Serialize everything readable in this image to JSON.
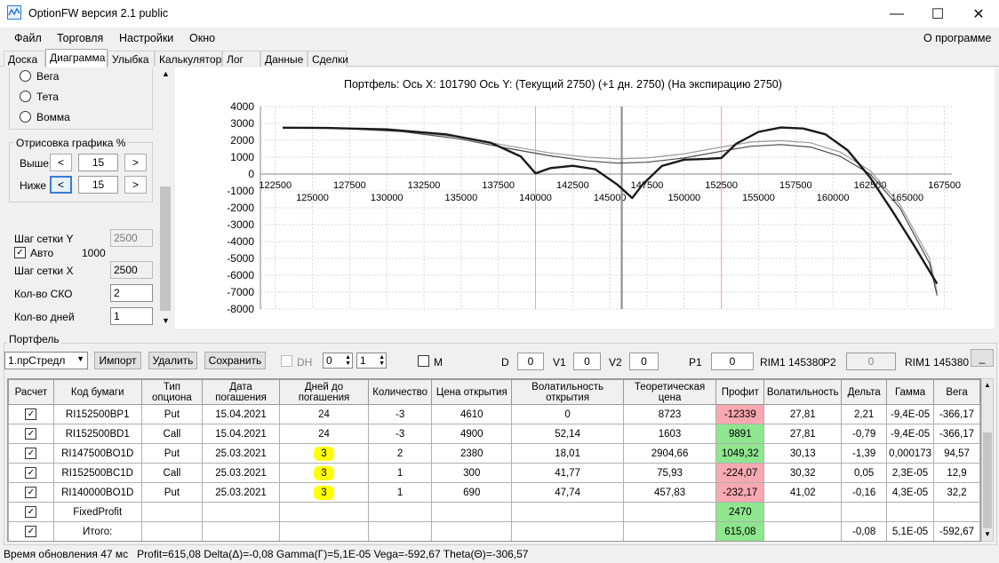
{
  "window": {
    "title": "OptionFW версия 2.1 public",
    "minimize": "—",
    "maximize": "☐",
    "close": "✕"
  },
  "menu": {
    "items": [
      "Файл",
      "Торговля",
      "Настройки",
      "Окно"
    ],
    "about": "О программе"
  },
  "tabs": [
    "Доска",
    "Диаграмма",
    "Улыбка",
    "Калькулятор",
    "Лог",
    "Данные",
    "Сделки"
  ],
  "left": {
    "radios": [
      "Вега",
      "Тета",
      "Вомма"
    ],
    "render_group": "Отрисовка графика %",
    "above_label": "Выше",
    "above_value": "15",
    "below_label": "Ниже",
    "below_value": "15",
    "prev": "<",
    "next": ">",
    "grid_y_label": "Шаг сетки Y",
    "grid_y_value": "2500",
    "auto_label": "Авто",
    "auto_value": "1000",
    "grid_x_label": "Шаг сетки X",
    "grid_x_value": "2500",
    "sko_label": "Кол-во СКО",
    "sko_value": "2",
    "days_label": "Кол-во дней",
    "days_value": "1"
  },
  "chart_data": {
    "type": "line",
    "title": "Портфель: Ось X: 101790 Ось Y: (Текущий 2750) (+1 дн. 2750) (На экспирацию 2750)",
    "x_top_ticks": [
      "122500",
      "127500",
      "132500",
      "137500",
      "142500",
      "147500",
      "152500",
      "157500",
      "162500",
      "167500"
    ],
    "x_bottom_ticks": [
      "125000",
      "130000",
      "135000",
      "140000",
      "145000",
      "150000",
      "155000",
      "160000",
      "165000"
    ],
    "y_ticks": [
      "4000",
      "3000",
      "2000",
      "1000",
      "0",
      "-1000",
      "-2000",
      "-3000",
      "-4000",
      "-5000",
      "-6000",
      "-7000",
      "-8000"
    ],
    "xlim": [
      121500,
      168000
    ],
    "ylim": [
      -8000,
      4000
    ],
    "vlines_red": [
      140000,
      152500
    ],
    "vline_current": 145800,
    "series": [
      {
        "color": "#1a1a1a",
        "x": [
          123000,
          126000,
          130000,
          134000,
          137000,
          139000,
          140000,
          141000,
          142500,
          144000,
          145500,
          146500,
          147200,
          148500,
          150000,
          151500,
          152500,
          153500,
          155000,
          156500,
          158000,
          159500,
          161000,
          162500,
          164000,
          165500,
          167000
        ],
        "y": [
          2750,
          2730,
          2650,
          2350,
          1850,
          1050,
          40,
          350,
          490,
          290,
          -620,
          -1420,
          -620,
          480,
          850,
          900,
          950,
          1800,
          2500,
          2760,
          2700,
          2350,
          1400,
          -200,
          -2200,
          -4300,
          -6500
        ]
      },
      {
        "color": "#4a4a4a",
        "x": [
          123000,
          127000,
          131000,
          135000,
          138000,
          141000,
          143500,
          145500,
          147500,
          150000,
          152500,
          154500,
          156500,
          158500,
          160500,
          162500,
          164500,
          166500,
          167000
        ],
        "y": [
          2750,
          2700,
          2520,
          2070,
          1550,
          1080,
          780,
          650,
          700,
          950,
          1350,
          1650,
          1750,
          1600,
          1050,
          0,
          -2000,
          -5300,
          -7200
        ]
      },
      {
        "color": "#9a9a9a",
        "x": [
          123000,
          127000,
          131000,
          135000,
          138000,
          141000,
          143500,
          145500,
          147500,
          150000,
          152500,
          154500,
          156500,
          158500,
          160500,
          162500,
          164500,
          166500,
          167000
        ],
        "y": [
          2750,
          2710,
          2560,
          2170,
          1700,
          1250,
          1000,
          900,
          950,
          1200,
          1600,
          1900,
          1980,
          1850,
          1300,
          200,
          -1800,
          -5000,
          -7000
        ]
      }
    ]
  },
  "portfolio": {
    "frame_label": "Портфель",
    "selector": "1.прСтредл",
    "import": "Импорт",
    "delete": "Удалить",
    "save": "Сохранить",
    "dh": "DH",
    "dh_a": "0",
    "dh_b": "1",
    "m": "M",
    "d_label": "D",
    "d_val": "0",
    "v1_label": "V1",
    "v1_val": "0",
    "v2_label": "V2",
    "v2_val": "0",
    "p1_label": "P1",
    "p1_val": "0",
    "rim1": "RIM1 145380",
    "p2_label": "P2",
    "p2_val": "0",
    "rim1b": "RIM1 145380",
    "more": "_"
  },
  "table": {
    "headers": [
      "Расчет",
      "Код бумаги",
      "Тип опциона",
      "Дата погашения",
      "Дней до погашения",
      "Количество",
      "Цена открытия",
      "Волатильность открытия",
      "Теоретическая цена",
      "Профит",
      "Волатильность",
      "Дельта",
      "Гамма",
      "Вега"
    ],
    "rows": [
      {
        "check": "✓",
        "code": "RI152500BP1",
        "type": "Put",
        "date": "15.04.2021",
        "days": "24",
        "qty": "-3",
        "price": "4610",
        "vol_open": "0",
        "theor": "8723",
        "profit": "-12339",
        "vol": "27,81",
        "delta": "2,21",
        "gamma": "-9,4E-05",
        "vega": "-366,17",
        "pc": "neg",
        "hl": false
      },
      {
        "check": "✓",
        "code": "RI152500BD1",
        "type": "Call",
        "date": "15.04.2021",
        "days": "24",
        "qty": "-3",
        "price": "4900",
        "vol_open": "52,14",
        "theor": "1603",
        "profit": "9891",
        "vol": "27,81",
        "delta": "-0,79",
        "gamma": "-9,4E-05",
        "vega": "-366,17",
        "pc": "pos",
        "hl": false
      },
      {
        "check": "✓",
        "code": "RI147500BO1D",
        "type": "Put",
        "date": "25.03.2021",
        "days": "3",
        "qty": "2",
        "price": "2380",
        "vol_open": "18,01",
        "theor": "2904,66",
        "profit": "1049,32",
        "vol": "30,13",
        "delta": "-1,39",
        "gamma": "0,000173",
        "vega": "94,57",
        "pc": "pos",
        "hl": true
      },
      {
        "check": "✓",
        "code": "RI152500BC1D",
        "type": "Call",
        "date": "25.03.2021",
        "days": "3",
        "qty": "1",
        "price": "300",
        "vol_open": "41,77",
        "theor": "75,93",
        "profit": "-224,07",
        "vol": "30,32",
        "delta": "0,05",
        "gamma": "2,3E-05",
        "vega": "12,9",
        "pc": "neg",
        "hl": true
      },
      {
        "check": "✓",
        "code": "RI140000BO1D",
        "type": "Put",
        "date": "25.03.2021",
        "days": "3",
        "qty": "1",
        "price": "690",
        "vol_open": "47,74",
        "theor": "457,83",
        "profit": "-232,17",
        "vol": "41,02",
        "delta": "-0,16",
        "gamma": "4,3E-05",
        "vega": "32,2",
        "pc": "neg",
        "hl": true
      },
      {
        "check": "✓",
        "code": "FixedProfit",
        "type": "",
        "date": "",
        "days": "",
        "qty": "",
        "price": "",
        "vol_open": "",
        "theor": "",
        "profit": "2470",
        "vol": "",
        "delta": "",
        "gamma": "",
        "vega": "",
        "pc": "pos",
        "hl": false
      },
      {
        "check": "✓",
        "code": "Итого:",
        "type": "",
        "date": "",
        "days": "",
        "qty": "",
        "price": "",
        "vol_open": "",
        "theor": "",
        "profit": "615,08",
        "vol": "",
        "delta": "-0,08",
        "gamma": "5,1E-05",
        "vega": "-592,67",
        "pc": "pos",
        "hl": false
      }
    ]
  },
  "status": "Время обновления 47 мс   Profit=615,08 Delta(Δ)=-0,08 Gamma(Γ)=5,1E-05 Vega=-592,67 Theta(Θ)=-306,57"
}
